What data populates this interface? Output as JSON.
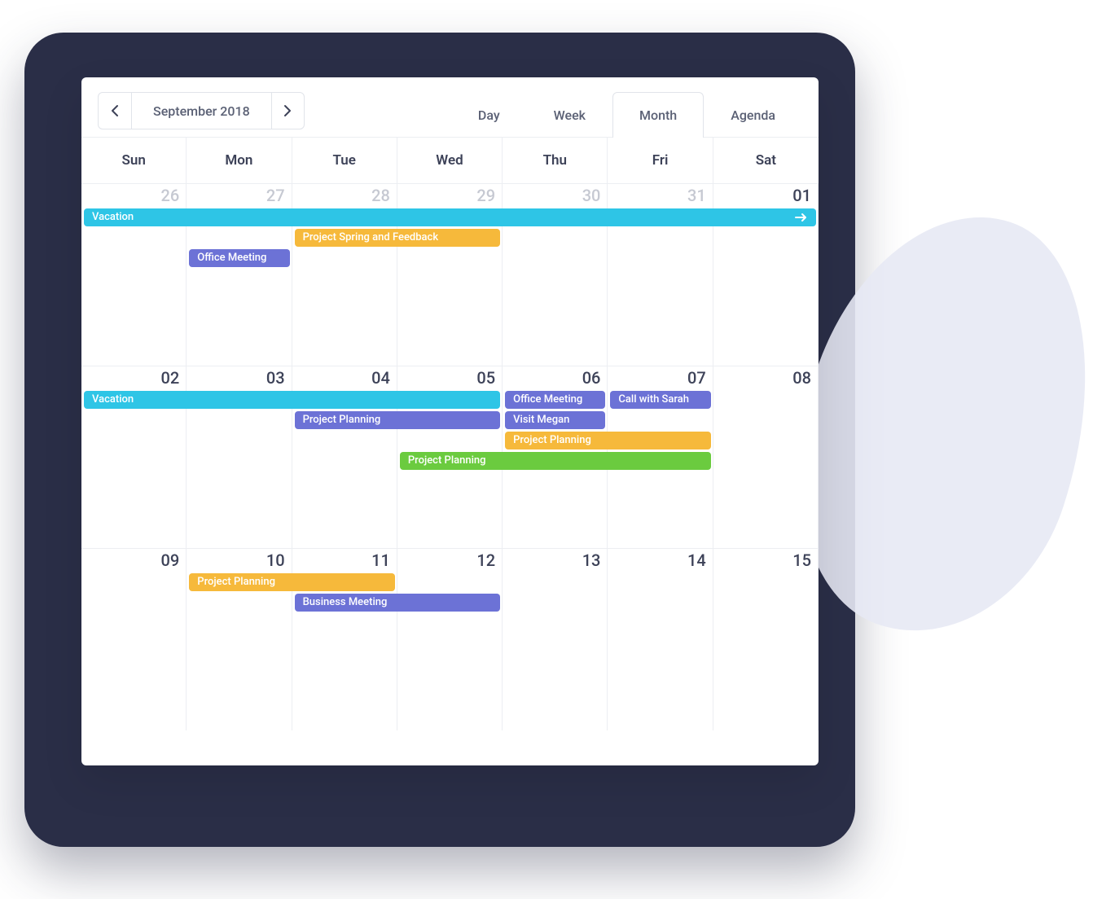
{
  "toolbar": {
    "title": "September 2018",
    "views": [
      "Day",
      "Week",
      "Month",
      "Agenda"
    ],
    "active_view": "Month"
  },
  "day_names": [
    "Sun",
    "Mon",
    "Tue",
    "Wed",
    "Thu",
    "Fri",
    "Sat"
  ],
  "weeks": [
    {
      "days": [
        {
          "num": "26",
          "muted": true
        },
        {
          "num": "27",
          "muted": true
        },
        {
          "num": "28",
          "muted": true
        },
        {
          "num": "29",
          "muted": true
        },
        {
          "num": "30",
          "muted": true
        },
        {
          "num": "31",
          "muted": true
        },
        {
          "num": "01",
          "muted": false
        }
      ],
      "events": [
        {
          "label": "Vacation",
          "color": "cyan",
          "start": 0,
          "span": 7,
          "row": 0,
          "continues": true
        },
        {
          "label": "Project Spring and Feedback",
          "color": "orange",
          "start": 2,
          "span": 2,
          "row": 1
        },
        {
          "label": "Office Meeting",
          "color": "purple",
          "start": 1,
          "span": 1,
          "row": 2
        }
      ]
    },
    {
      "days": [
        {
          "num": "02"
        },
        {
          "num": "03"
        },
        {
          "num": "04"
        },
        {
          "num": "05"
        },
        {
          "num": "06"
        },
        {
          "num": "07"
        },
        {
          "num": "08"
        }
      ],
      "events": [
        {
          "label": "Vacation",
          "color": "cyan",
          "start": 0,
          "span": 4,
          "row": 0
        },
        {
          "label": "Office Meeting",
          "color": "purple",
          "start": 4,
          "span": 1,
          "row": 0
        },
        {
          "label": "Call with Sarah",
          "color": "purple",
          "start": 5,
          "span": 1,
          "row": 0
        },
        {
          "label": "Project Planning",
          "color": "purple",
          "start": 2,
          "span": 2,
          "row": 1
        },
        {
          "label": "Visit Megan",
          "color": "purple",
          "start": 4,
          "span": 1,
          "row": 1
        },
        {
          "label": "Project Planning",
          "color": "orange",
          "start": 4,
          "span": 2,
          "row": 2
        },
        {
          "label": "Project Planning",
          "color": "green",
          "start": 3,
          "span": 3,
          "row": 3
        }
      ]
    },
    {
      "days": [
        {
          "num": "09"
        },
        {
          "num": "10"
        },
        {
          "num": "11"
        },
        {
          "num": "12"
        },
        {
          "num": "13"
        },
        {
          "num": "14"
        },
        {
          "num": "15"
        }
      ],
      "events": [
        {
          "label": "Project Planning",
          "color": "orange",
          "start": 1,
          "span": 2,
          "row": 0
        },
        {
          "label": "Business Meeting",
          "color": "purple",
          "start": 2,
          "span": 2,
          "row": 1
        }
      ]
    }
  ],
  "colors": {
    "cyan": "#2ec5e6",
    "orange": "#f6b93b",
    "purple": "#6c72d6",
    "green": "#6bcb3f"
  }
}
